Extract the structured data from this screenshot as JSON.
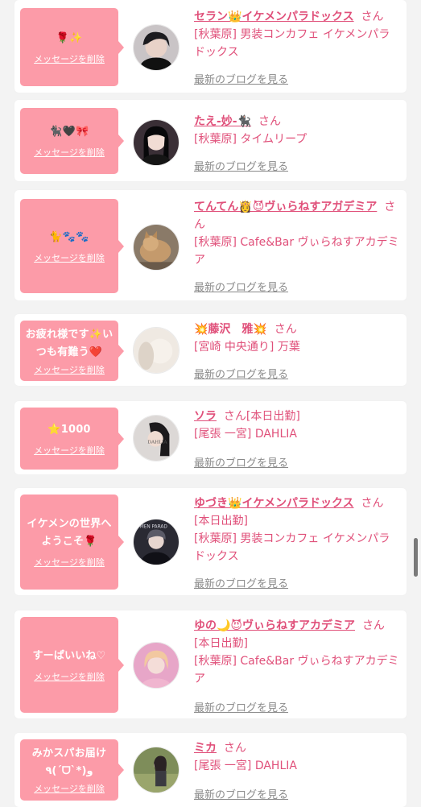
{
  "cards": [
    {
      "message": "🌹✨",
      "delete_label": "メッセージを削除",
      "name": "セラン👑イケメンパラドックス",
      "san": "さん",
      "shop_line": "[秋葉原] 男装コンカフェ イケメンパラドックス",
      "blog_label": "最新のブログを見る",
      "avatar_desc": "dark-hair-person-avatar"
    },
    {
      "message": "🐈‍⬛🖤🎀",
      "delete_label": "メッセージを削除",
      "name": "たえ-妙-🐈‍⬛",
      "san": "さん",
      "shop_line": "[秋葉原] タイムリープ",
      "blog_label": "最新のブログを見る",
      "avatar_desc": "black-hair-girl-avatar"
    },
    {
      "message": "🐈🐾🐾",
      "delete_label": "メッセージを削除",
      "name": "てんてん👸😈ヴぃらねすアガデミア",
      "san": "さん",
      "shop_line": "[秋葉原] Cafe&Bar ヴぃらねすアカデミア",
      "blog_label": "最新のブログを見る",
      "avatar_desc": "cat-avatar"
    },
    {
      "message": "お疲れ様です✨いつも有難う❤️",
      "delete_label": "メッセージを削除",
      "name": "💥藤沢　雅💥",
      "san": "さん",
      "shop_line": "[宮崎 中央通り] 万葉",
      "blog_label": "最新のブログを見る",
      "avatar_desc": "light-blurred-avatar"
    },
    {
      "message": "⭐1000",
      "delete_label": "メッセージを削除",
      "name": "ソラ",
      "san": "さん[本日出勤]",
      "shop_line": "[尾張 一宮] DAHLIA",
      "blog_label": "最新のブログを見る",
      "avatar_desc": "dahlia-girl-avatar"
    },
    {
      "message": "イケメンの世界へようこそ🌹",
      "delete_label": "メッセージを削除",
      "name": "ゆづき👑イケメンパラドックス",
      "san": "さん",
      "status": "[本日出勤]",
      "shop_line": "[秋葉原] 男装コンカフェ イケメンパラドックス",
      "blog_label": "最新のブログを見る",
      "avatar_desc": "suit-person-avatar"
    },
    {
      "message": "すーぱいいね♡",
      "delete_label": "メッセージを削除",
      "name": "ゆの🌙😈ヴぃらねすアカデミア",
      "san": "さん[本日出勤]",
      "shop_line": "[秋葉原] Cafe&Bar ヴぃらねすアカデミア",
      "blog_label": "最新のブログを見る",
      "avatar_desc": "blonde-girl-avatar"
    },
    {
      "message": "みかスパお届け٩(ˊᗜˋ*)و",
      "delete_label": "メッセージを削除",
      "name": "ミカ",
      "san": "さん",
      "shop_line": "[尾張 一宮] DAHLIA",
      "blog_label": "最新のブログを見る",
      "avatar_desc": "outdoor-girl-avatar"
    }
  ]
}
